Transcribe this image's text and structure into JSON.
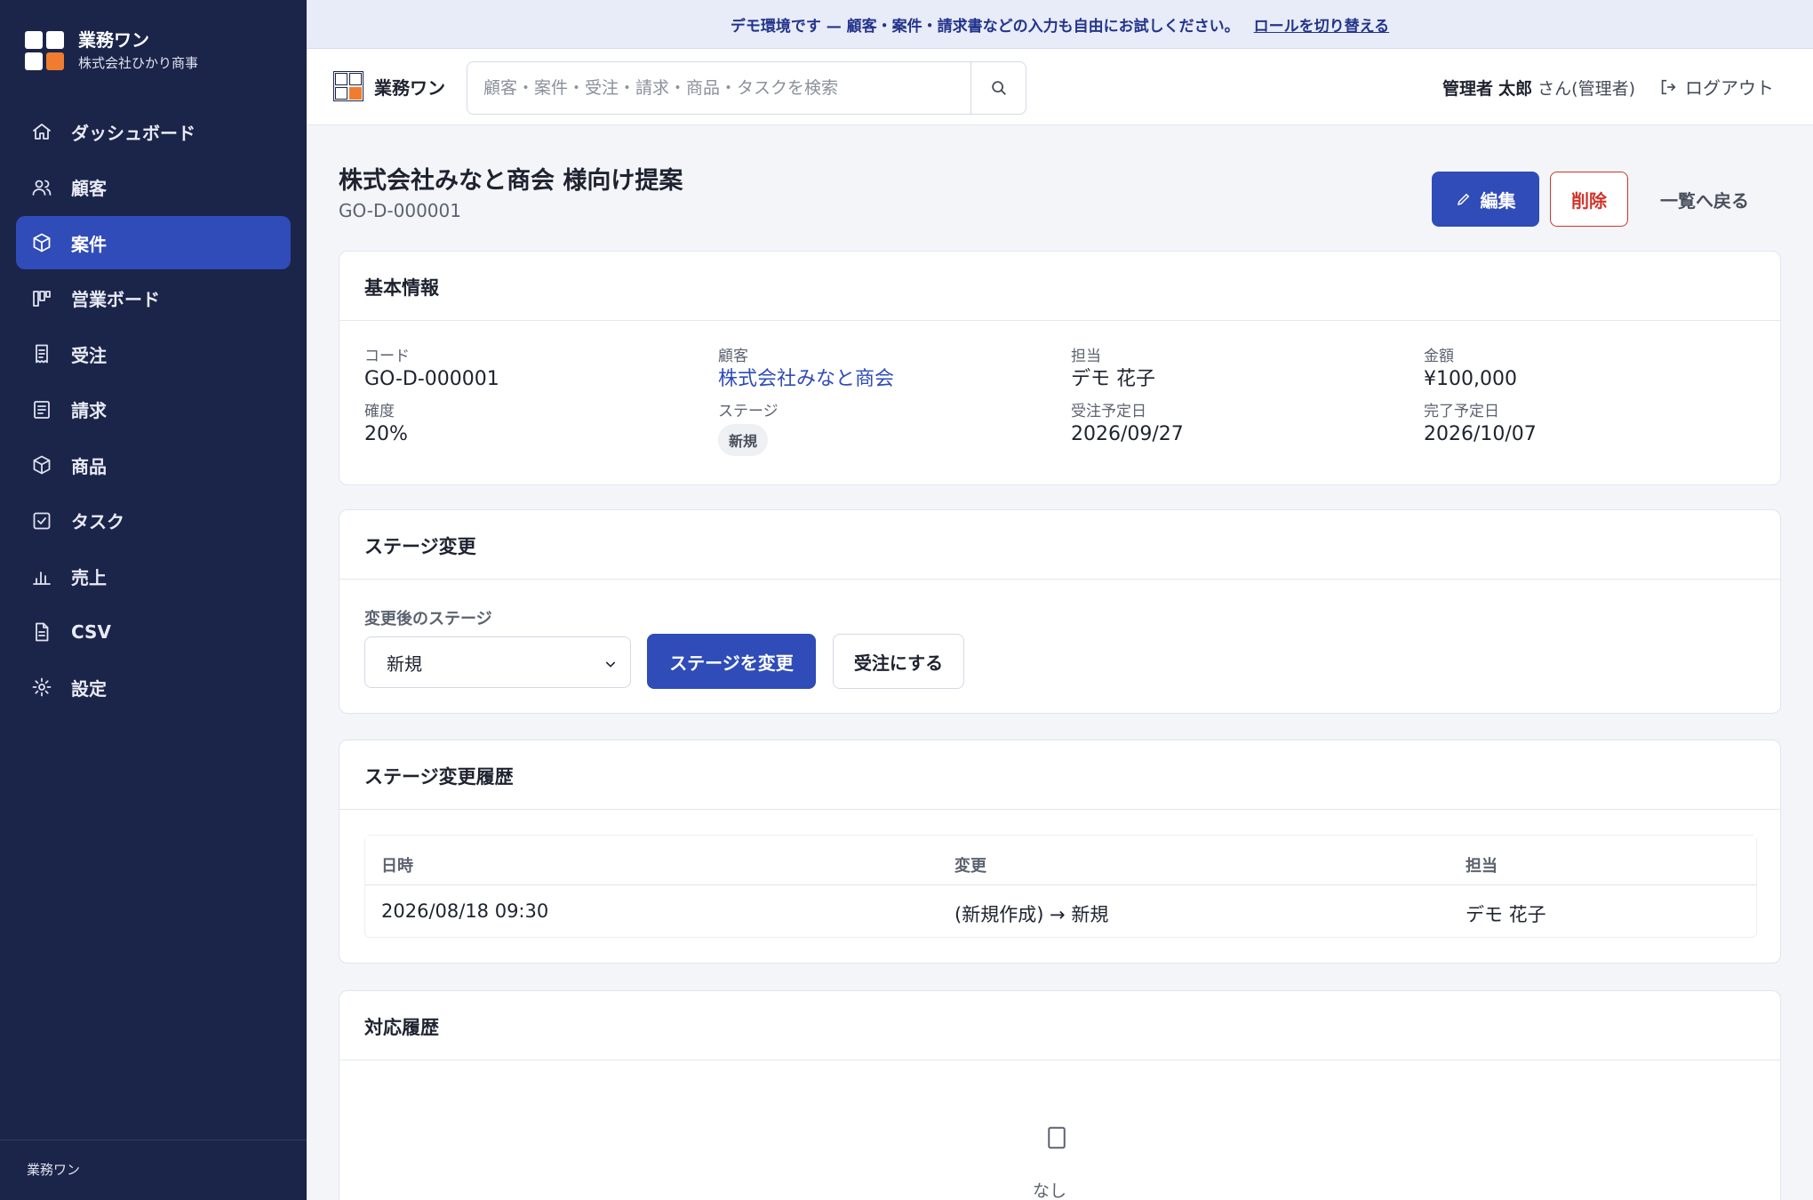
{
  "banner": {
    "message": "デモ環境です — 顧客・案件・請求書などの入力も自由にお試しください。",
    "link_label": "ロールを切り替える"
  },
  "sidebar": {
    "brand_name": "業務ワン",
    "company": "株式会社ひかり商事",
    "items": [
      {
        "label": "ダッシュボード",
        "icon": "home-icon"
      },
      {
        "label": "顧客",
        "icon": "users-icon"
      },
      {
        "label": "案件",
        "icon": "box-icon",
        "active": true
      },
      {
        "label": "営業ボード",
        "icon": "kanban-icon"
      },
      {
        "label": "受注",
        "icon": "receipt-icon"
      },
      {
        "label": "請求",
        "icon": "document-icon"
      },
      {
        "label": "商品",
        "icon": "package-icon"
      },
      {
        "label": "タスク",
        "icon": "checkbox-icon"
      },
      {
        "label": "売上",
        "icon": "bar-chart-icon"
      },
      {
        "label": "CSV",
        "icon": "file-icon"
      },
      {
        "label": "設定",
        "icon": "gear-icon"
      }
    ],
    "footer": "業務ワン"
  },
  "topbar": {
    "brand_name": "業務ワン",
    "search_placeholder": "顧客・案件・受注・請求・商品・タスクを検索",
    "user_role": "管理者",
    "user_name": "太郎",
    "user_suffix": "さん(管理者)",
    "logout_label": "ログアウト"
  },
  "page": {
    "title": "株式会社みなと商会 様向け提案",
    "code": "GO-D-000001",
    "edit_label": "編集",
    "delete_label": "削除",
    "back_label": "一覧へ戻る"
  },
  "basic_info": {
    "heading": "基本情報",
    "fields": {
      "code": {
        "label": "コード",
        "value": "GO-D-000001"
      },
      "customer": {
        "label": "顧客",
        "value": "株式会社みなと商会"
      },
      "owner": {
        "label": "担当",
        "value": "デモ 花子"
      },
      "amount": {
        "label": "金額",
        "value": "¥100,000"
      },
      "probability": {
        "label": "確度",
        "value": "20%"
      },
      "stage": {
        "label": "ステージ",
        "value": "新規"
      },
      "expected_order_date": {
        "label": "受注予定日",
        "value": "2026/09/27"
      },
      "expected_close_date": {
        "label": "完了予定日",
        "value": "2026/10/07"
      }
    }
  },
  "stage_change": {
    "heading": "ステージ変更",
    "select_label": "変更後のステージ",
    "selected": "新規",
    "change_button": "ステージを変更",
    "order_button": "受注にする"
  },
  "stage_history": {
    "heading": "ステージ変更履歴",
    "columns": [
      "日時",
      "変更",
      "担当"
    ],
    "rows": [
      [
        "2026/08/18 09:30",
        "(新規作成) → 新規",
        "デモ 花子"
      ]
    ]
  },
  "activity_history": {
    "heading": "対応履歴",
    "empty_text": "なし"
  },
  "colors": {
    "sidebar_bg": "#1b2449",
    "accent": "#2f4cb8",
    "logo_orange": "#f07c2f",
    "danger": "#d0342c"
  }
}
